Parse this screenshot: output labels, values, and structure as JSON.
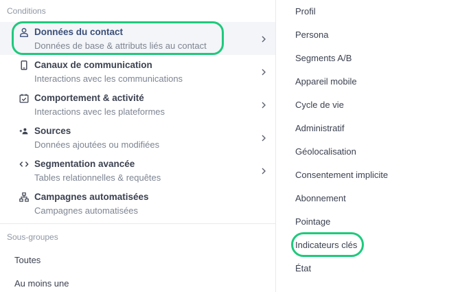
{
  "conditions": {
    "header": "Conditions",
    "items": [
      {
        "icon": "person-icon",
        "title": "Données du contact",
        "description": "Données de base & attributs liés au contact"
      },
      {
        "icon": "phone-icon",
        "title": "Canaux de communication",
        "description": "Interactions avec les communications"
      },
      {
        "icon": "calendar-check-icon",
        "title": "Comportement & activité",
        "description": "Interactions avec les plateformes"
      },
      {
        "icon": "people-plus-icon",
        "title": "Sources",
        "description": "Données ajoutées ou modifiées"
      },
      {
        "icon": "code-brackets-icon",
        "title": "Segmentation avancée",
        "description": "Tables relationnelles & requêtes"
      },
      {
        "icon": "sitemap-icon",
        "title": "Campagnes automatisées",
        "description": "Campagnes automatisées"
      }
    ]
  },
  "subgroups": {
    "header": "Sous-groupes",
    "items": [
      "Toutes",
      "Au moins une"
    ]
  },
  "attributes": {
    "items": [
      "Profil",
      "Persona",
      "Segments A/B",
      "Appareil mobile",
      "Cycle de vie",
      "Administratif",
      "Géolocalisation",
      "Consentement implicite",
      "Abonnement",
      "Pointage",
      "Indicateurs clés",
      "État"
    ]
  },
  "colors": {
    "highlight": "#1ec97c",
    "active_row_bg": "#f3f5f8",
    "active_title": "#3a4e79",
    "text": "#3b4150",
    "muted": "#7d8491"
  }
}
